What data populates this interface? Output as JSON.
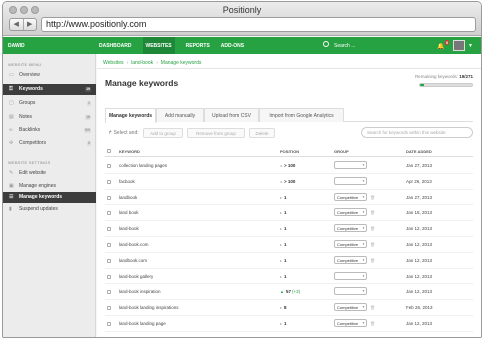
{
  "window": {
    "title": "Positionly",
    "url": "http://www.positionly.com"
  },
  "topnav": {
    "brand": "DAWID",
    "links": [
      "DASHBOARD",
      "WEBSITES",
      "REPORTS",
      "ADD-ONS"
    ],
    "active": "WEBSITES",
    "search_placeholder": "Search ...",
    "notifications": "0"
  },
  "sidebar": {
    "website_menu_label": "WEBSITE MENU",
    "menu": [
      {
        "label": "Overview",
        "count": "",
        "icon": "monitor-icon"
      },
      {
        "label": "Keywords",
        "count": "19",
        "icon": "key-icon"
      },
      {
        "label": "Groups",
        "count": "1",
        "icon": "folder-icon"
      },
      {
        "label": "Notes",
        "count": "18",
        "icon": "note-icon"
      },
      {
        "label": "Backlinks",
        "count": "5/9",
        "icon": "link-icon"
      },
      {
        "label": "Competitors",
        "count": "0",
        "icon": "competitors-icon"
      }
    ],
    "website_settings_label": "WEBSITE SETTINGS",
    "settings": [
      {
        "label": "Edit website",
        "icon": "pencil-icon"
      },
      {
        "label": "Manage engines",
        "icon": "engine-icon"
      },
      {
        "label": "Manage keywords",
        "icon": "list-icon"
      },
      {
        "label": "Suspend updates",
        "icon": "pause-icon"
      }
    ]
  },
  "breadcrumb": [
    "Websites",
    "land-book",
    "Manage keywords"
  ],
  "page": {
    "title": "Manage keywords",
    "remaining_label": "Remaining keywords:",
    "remaining_value": "19/271",
    "remaining_fraction": 0.07
  },
  "tabs": [
    "Manage keywords",
    "Add manually",
    "Upload from CSV",
    "Import from Google Analytics"
  ],
  "actions": {
    "select_label": "Select and:",
    "add_group": "Add to group",
    "remove_group": "Remove from group",
    "delete": "Delete",
    "search_placeholder": "Search for keywords within this website"
  },
  "table": {
    "columns": [
      "KEYWORD",
      "POSITION",
      "GROUP",
      "DATE ADDED"
    ],
    "rows": [
      {
        "keyword": "collection landing pages",
        "position": "> 100",
        "change": "",
        "group": "",
        "date": "Jan 27, 2013"
      },
      {
        "keyword": "facbook",
        "position": "> 100",
        "change": "",
        "group": "",
        "date": "Apr 26, 2013"
      },
      {
        "keyword": "landbook",
        "position": "1",
        "change": "",
        "group": "Competitive",
        "date": "Jan 27, 2013"
      },
      {
        "keyword": "land book",
        "position": "1",
        "change": "",
        "group": "Competitive",
        "date": "Jan 18, 2013"
      },
      {
        "keyword": "land-book",
        "position": "1",
        "change": "",
        "group": "Competitive",
        "date": "Jan 12, 2013"
      },
      {
        "keyword": "land-book.com",
        "position": "1",
        "change": "",
        "group": "Competitive",
        "date": "Jan 12, 2013"
      },
      {
        "keyword": "landbook.com",
        "position": "1",
        "change": "",
        "group": "Competitive",
        "date": "Jan 12, 2013"
      },
      {
        "keyword": "land-book gallery",
        "position": "1",
        "change": "",
        "group": "",
        "date": "Jan 12, 2013"
      },
      {
        "keyword": "land-book inspiration",
        "position": "57",
        "change": "(+3)",
        "group": "",
        "date": "Jan 12, 2013"
      },
      {
        "keyword": "land-book landing inspirations",
        "position": "8",
        "change": "",
        "group": "Competitive",
        "date": "Feb 26, 2013"
      },
      {
        "keyword": "land-book landing page",
        "position": "1",
        "change": "",
        "group": "Competitive",
        "date": "Jan 12, 2013"
      }
    ]
  }
}
